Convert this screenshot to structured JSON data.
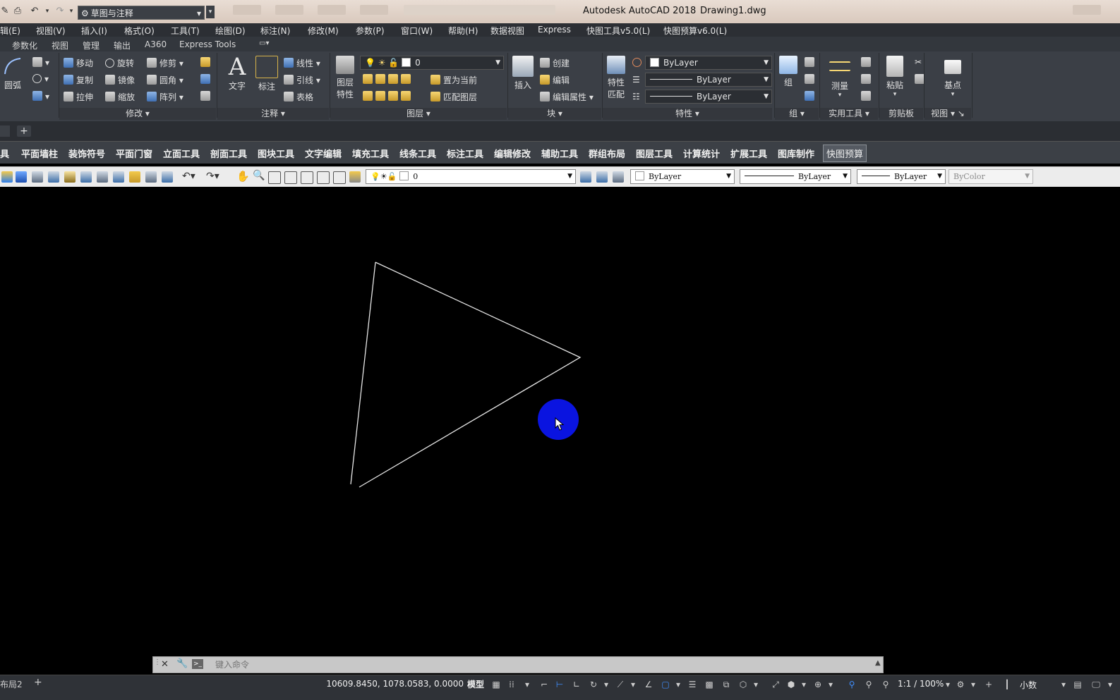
{
  "title_bar": {
    "workspace": "草图与注释",
    "app_title": "Autodesk AutoCAD 2018",
    "file_title": "Drawing1.dwg"
  },
  "menu": [
    "辑(E)",
    "视图(V)",
    "插入(I)",
    "格式(O)",
    "工具(T)",
    "绘图(D)",
    "标注(N)",
    "修改(M)",
    "参数(P)",
    "窗口(W)",
    "帮助(H)",
    "数据视图",
    "Express",
    "快图工具v5.0(L)",
    "快图预算v6.0(L)"
  ],
  "ribbon_tabs": [
    "参数化",
    "视图",
    "管理",
    "输出",
    "A360",
    "Express Tools"
  ],
  "ribbon": {
    "draw": {
      "arc": "圆弧"
    },
    "modify": {
      "title": "修改",
      "move": "移动",
      "rotate": "旋转",
      "trim": "修剪",
      "copy": "复制",
      "mirror": "镜像",
      "fillet": "圆角",
      "stretch": "拉伸",
      "scale": "缩放",
      "array": "阵列"
    },
    "annotation": {
      "title": "注释",
      "text": "文字",
      "dimension": "标注",
      "linear": "线性",
      "leader": "引线",
      "table": "表格"
    },
    "layers": {
      "title": "图层",
      "properties_line1": "图层",
      "properties_line2": "特性",
      "current_layer": "0",
      "set_current": "置为当前",
      "match_layer": "匹配图层"
    },
    "block": {
      "title": "块",
      "insert": "插入",
      "create": "创建",
      "edit": "编辑",
      "edit_attr": "编辑属性"
    },
    "properties": {
      "title": "特性",
      "match_line1": "特性",
      "match_line2": "匹配",
      "color": "ByLayer",
      "linetype": "ByLayer",
      "lineweight": "ByLayer"
    },
    "groups": {
      "title": "组",
      "group": "组"
    },
    "utilities": {
      "title": "实用工具",
      "measure": "测量"
    },
    "clipboard": {
      "title": "剪贴板",
      "paste": "粘贴"
    },
    "view": {
      "title": "视图",
      "base": "基点"
    }
  },
  "plugin_toolbar": [
    "具",
    "平面墙柱",
    "装饰符号",
    "平面门窗",
    "立面工具",
    "剖面工具",
    "图块工具",
    "文字编辑",
    "填充工具",
    "线条工具",
    "标注工具",
    "编辑修改",
    "辅助工具",
    "群组布局",
    "图层工具",
    "计算统计",
    "扩展工具",
    "图库制作",
    "快图预算"
  ],
  "classic_toolbar": {
    "layer": "0",
    "color": "ByLayer",
    "linetype": "ByLayer",
    "lineweight": "ByLayer",
    "plotstyle": "ByColor"
  },
  "command_line": {
    "placeholder": "键入命令"
  },
  "status_bar": {
    "layout_tab": "布局2",
    "coordinates": "10609.8450, 1078.0583, 0.0000",
    "model": "模型",
    "scale": "1:1 / 100%",
    "units": "小数"
  },
  "colors": {
    "canvas": "#000000",
    "triangle_stroke": "#e6e6e6",
    "cursor_marker": "#0a14e0",
    "ribbon_bg": "#3b3f46",
    "accent_blue": "#3f8fff"
  }
}
